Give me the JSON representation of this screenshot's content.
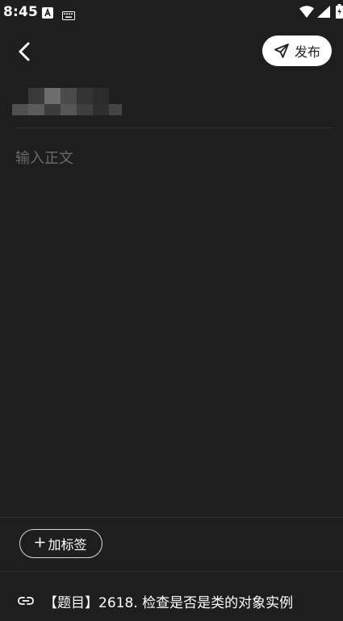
{
  "status_bar": {
    "time": "8:45"
  },
  "header": {
    "publish_label": "发布"
  },
  "editor": {
    "body_placeholder": "输入正文"
  },
  "footer": {
    "add_tag_label": "加标签",
    "linked_problem": "【题目】2618. 检查是否是类的对象实例"
  },
  "icons": {
    "back": "chevron-left-icon",
    "send": "send-icon",
    "link": "link-icon",
    "add": "plus-icon"
  },
  "colors": {
    "background": "#1e1e1e",
    "text": "#ffffff",
    "placeholder": "#6a6a6a",
    "divider": "#333333",
    "publish_button_bg": "#ffffff"
  }
}
